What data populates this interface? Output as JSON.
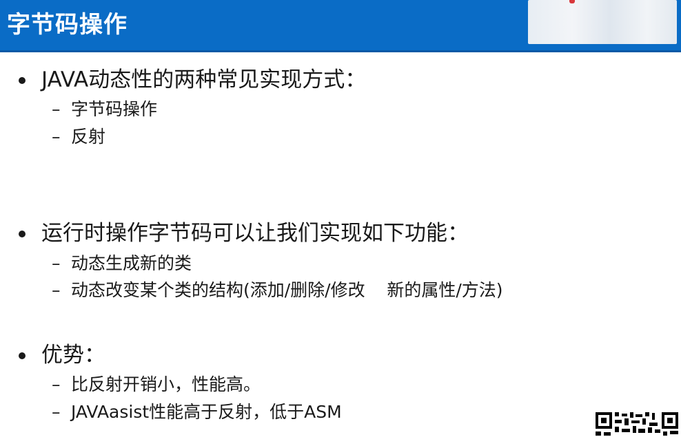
{
  "slide": {
    "title": "字节码操作",
    "sections": [
      {
        "heading": "JAVA动态性的两种常见实现方式：",
        "items": [
          "字节码操作",
          "反射"
        ]
      },
      {
        "heading": "运行时操作字节码可以让我们实现如下功能：",
        "items": [
          "动态生成新的类",
          "动态改变某个类的结构(添加/删除/修改    新的属性/方法)"
        ]
      },
      {
        "heading": "优势：",
        "items": [
          "比反射开销小，性能高。",
          "JAVAasist性能高于反射，低于ASM"
        ]
      }
    ],
    "dash_glyph": "–",
    "colors": {
      "title_bar": "#0a6cc6",
      "text": "#1a1a1a"
    }
  }
}
